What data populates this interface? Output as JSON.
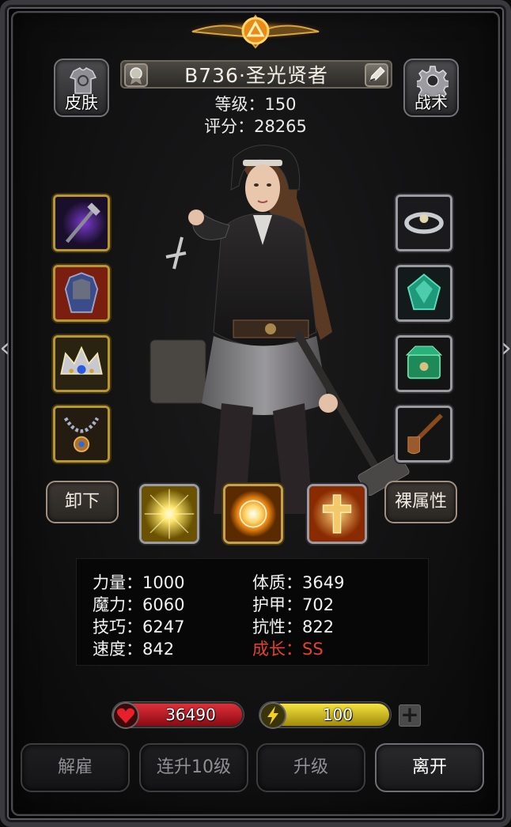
{
  "header": {
    "character_name": "B736·圣光贤者",
    "level_label": "等级：150",
    "score_label": "评分：28265",
    "skin_button": "皮肤",
    "tactics_button": "战术",
    "badge_icon": "medal-icon",
    "edit_icon": "pencil-icon"
  },
  "equipment": {
    "left": [
      {
        "name": "staff",
        "icon": "staff-icon",
        "rarity": "gold"
      },
      {
        "name": "armor",
        "icon": "armor-icon",
        "rarity": "gold"
      },
      {
        "name": "crown",
        "icon": "crown-icon",
        "rarity": "gold"
      },
      {
        "name": "necklace",
        "icon": "necklace-icon",
        "rarity": "gold"
      }
    ],
    "right": [
      {
        "name": "ring",
        "icon": "ring-icon",
        "rarity": "silver"
      },
      {
        "name": "gem",
        "icon": "gem-icon",
        "rarity": "silver"
      },
      {
        "name": "box",
        "icon": "jade-box-icon",
        "rarity": "silver"
      },
      {
        "name": "pipe",
        "icon": "pipe-icon",
        "rarity": "silver"
      }
    ]
  },
  "actions": {
    "unequip": "卸下",
    "base_attributes": "裸属性"
  },
  "skills": [
    {
      "icon": "light-burst-icon"
    },
    {
      "icon": "sun-orb-icon"
    },
    {
      "icon": "holy-cross-icon"
    }
  ],
  "stats": {
    "strength": "力量：1000",
    "magic": "魔力：6060",
    "skill": "技巧：6247",
    "speed": "速度：842",
    "constitution": "体质：3649",
    "armor": "护甲：702",
    "resistance": "抗性：822",
    "growth": "成长：SS"
  },
  "resources": {
    "hp": "36490",
    "energy": "100",
    "hp_color": "#c0141c",
    "energy_color": "#d9c31c",
    "growth_color": "#e5412a"
  },
  "footer": {
    "dismiss": "解雇",
    "upgrade10": "连升10级",
    "upgrade": "升级",
    "leave": "离开"
  }
}
